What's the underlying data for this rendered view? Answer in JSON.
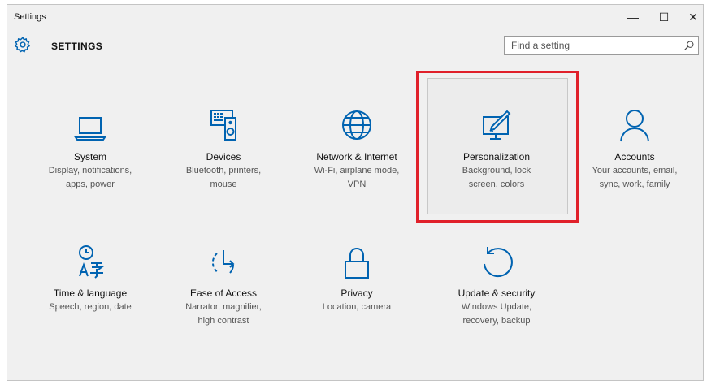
{
  "window": {
    "title": "Settings",
    "minimize_glyph": "—",
    "maximize_glyph": "☐",
    "close_glyph": "✕"
  },
  "header": {
    "title": "SETTINGS",
    "icon": "gear-icon"
  },
  "search": {
    "placeholder": "Find a setting",
    "value": "",
    "icon": "search-icon"
  },
  "accent_color": "#0063b1",
  "highlight_color": "#e0202a",
  "tiles": [
    {
      "label": "System",
      "desc_1": "Display, notifications,",
      "desc_2": "apps, power",
      "icon": "laptop-icon"
    },
    {
      "label": "Devices",
      "desc_1": "Bluetooth, printers,",
      "desc_2": "mouse",
      "icon": "devices-icon"
    },
    {
      "label": "Network & Internet",
      "desc_1": "Wi-Fi, airplane mode,",
      "desc_2": "VPN",
      "icon": "globe-icon"
    },
    {
      "label": "Personalization",
      "desc_1": "Background, lock",
      "desc_2": "screen, colors",
      "icon": "paint-brush-icon"
    },
    {
      "label": "Accounts",
      "desc_1": "Your accounts, email,",
      "desc_2": "sync, work, family",
      "icon": "user-icon"
    },
    {
      "label": "Time & language",
      "desc_1": "Speech, region, date",
      "desc_2": "",
      "icon": "time-language-icon"
    },
    {
      "label": "Ease of Access",
      "desc_1": "Narrator, magnifier,",
      "desc_2": "high contrast",
      "icon": "ease-of-access-icon"
    },
    {
      "label": "Privacy",
      "desc_1": "Location, camera",
      "desc_2": "",
      "icon": "lock-icon"
    },
    {
      "label": "Update & security",
      "desc_1": "Windows Update,",
      "desc_2": "recovery, backup",
      "icon": "refresh-icon"
    }
  ]
}
